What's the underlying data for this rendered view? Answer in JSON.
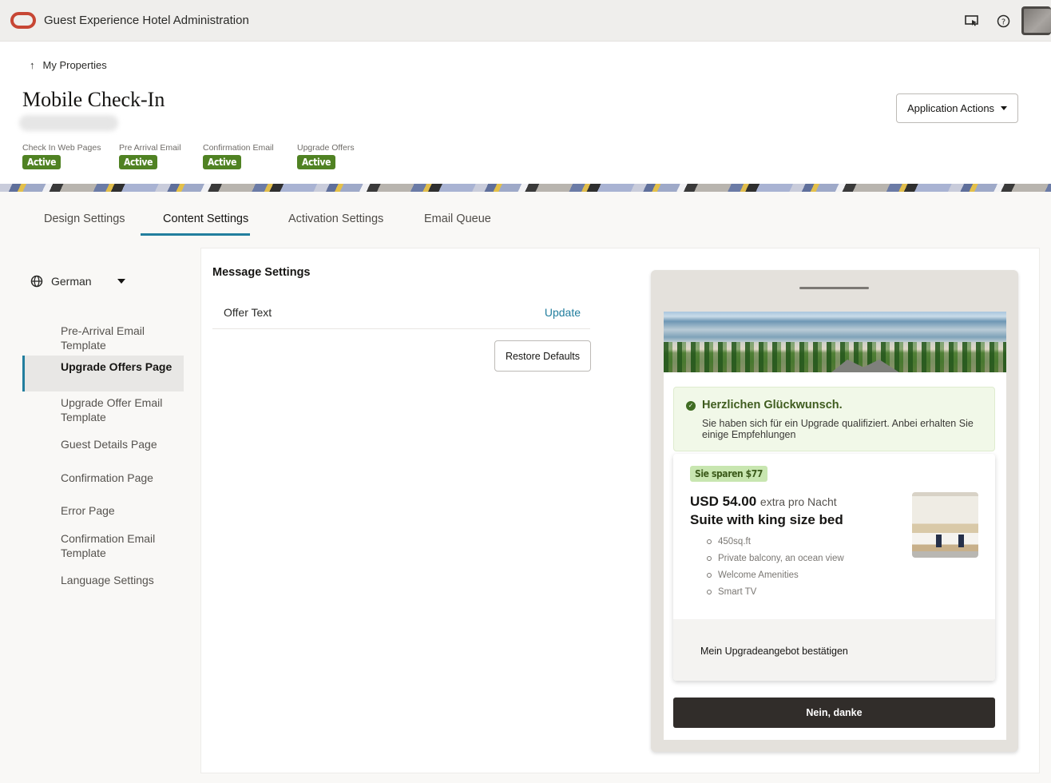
{
  "header": {
    "app_title": "Guest Experience Hotel Administration",
    "icons": [
      "cast-screen-icon",
      "help-icon"
    ]
  },
  "page": {
    "back_link": "My Properties",
    "title": "Mobile Check-In",
    "statuses": [
      {
        "label": "Check In Web Pages",
        "value": "Active"
      },
      {
        "label": "Pre Arrival Email",
        "value": "Active"
      },
      {
        "label": "Confirmation Email",
        "value": "Active"
      },
      {
        "label": "Upgrade Offers",
        "value": "Active"
      }
    ],
    "actions_button": "Application Actions"
  },
  "tabs": [
    {
      "label": "Design Settings",
      "active": false
    },
    {
      "label": "Content Settings",
      "active": true
    },
    {
      "label": "Activation Settings",
      "active": false
    },
    {
      "label": "Email Queue",
      "active": false
    }
  ],
  "sidebar": {
    "language": "German",
    "items": [
      {
        "label": "Pre-Arrival Email Template",
        "active": false
      },
      {
        "label": "Upgrade Offers Page",
        "active": true
      },
      {
        "label": "Upgrade Offer Email Template",
        "active": false
      },
      {
        "label": "Guest Details Page",
        "active": false
      },
      {
        "label": "Confirmation Page",
        "active": false
      },
      {
        "label": "Error Page",
        "active": false
      },
      {
        "label": "Confirmation Email Template",
        "active": false
      },
      {
        "label": "Language Settings",
        "active": false
      }
    ]
  },
  "message_settings": {
    "title": "Message Settings",
    "rows": [
      {
        "label": "Offer Text",
        "action": "Update"
      }
    ],
    "restore_button": "Restore Defaults"
  },
  "preview": {
    "alert_title": "Herzlichen Glückwunsch.",
    "alert_body": "Sie haben sich für ein Upgrade qualifiziert. Anbei erhalten Sie einige Empfehlungen",
    "savings_badge": "Sie sparen $77",
    "price": "USD 54.00",
    "price_suffix": "extra pro Nacht",
    "room_name": "Suite with king size bed",
    "amenities": [
      "450sq.ft",
      "Private balcony, an ocean view",
      "Welcome Amenities",
      "Smart TV"
    ],
    "confirm_label": "Mein Upgradeangebot bestätigen",
    "decline_label": "Nein, danke"
  },
  "colors": {
    "accent": "#227e9e",
    "badge_green": "#508223",
    "oracle_red": "#c74634",
    "dark_button": "#312d2a"
  }
}
